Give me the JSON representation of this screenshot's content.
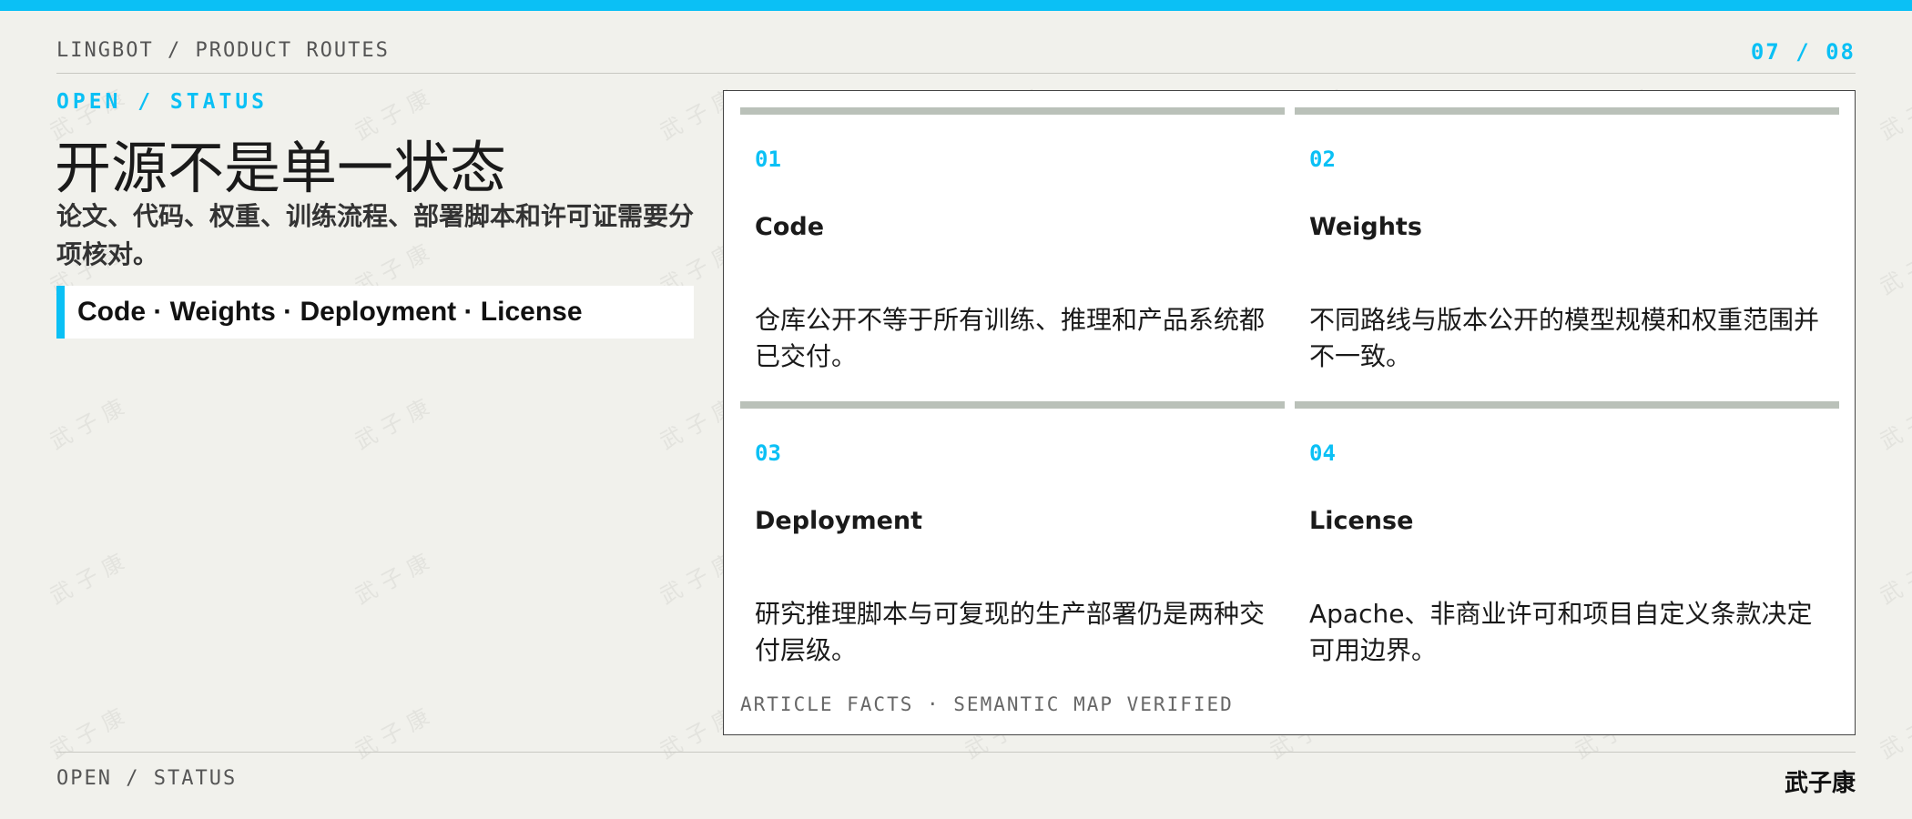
{
  "header": {
    "brand": "LINGBOT / PRODUCT ROUTES",
    "page_indicator": "07 / 08"
  },
  "hero": {
    "kicker": "OPEN / STATUS",
    "title": "开源不是单一状态",
    "subtitle": "论文、代码、权重、训练流程、部署脚本和许可证需要分项核对。",
    "tagline": "Code · Weights · Deployment · License"
  },
  "cards": [
    {
      "number": "01",
      "title": "Code",
      "description": "仓库公开不等于所有训练、推理和产品系统都已交付。"
    },
    {
      "number": "02",
      "title": "Weights",
      "description": "不同路线与版本公开的模型规模和权重范围并不一致。"
    },
    {
      "number": "03",
      "title": "Deployment",
      "description": "研究推理脚本与可复现的生产部署仍是两种交付层级。"
    },
    {
      "number": "04",
      "title": "License",
      "description": "Apache、非商业许可和项目自定义条款决定可用边界。"
    }
  ],
  "panel_footer": "ARTICLE FACTS · SEMANTIC MAP VERIFIED",
  "footer": {
    "section": "OPEN / STATUS",
    "author": "武子康"
  },
  "watermark": "武子康",
  "colors": {
    "accent": "#0bc0f5",
    "background": "#f1f1ec",
    "card_bar": "#bac1b9"
  }
}
